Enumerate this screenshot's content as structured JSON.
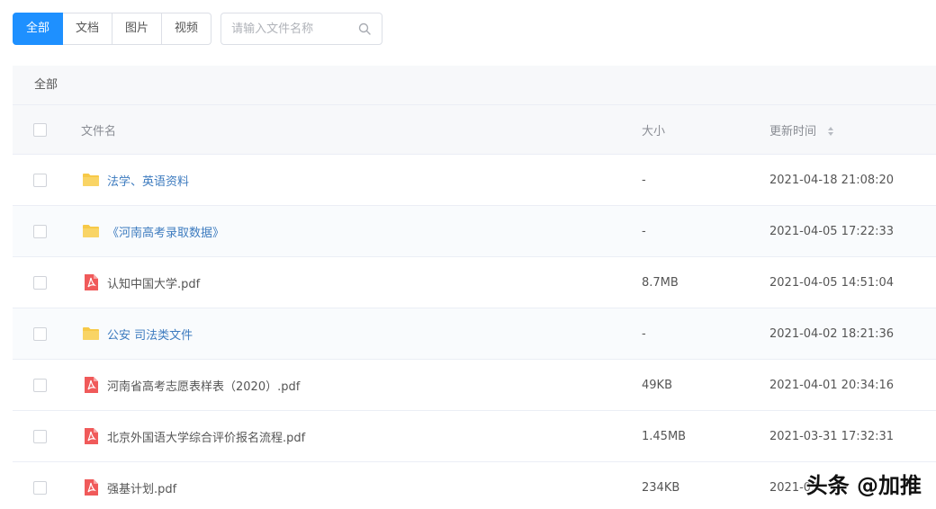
{
  "tabs": [
    {
      "label": "全部",
      "active": true
    },
    {
      "label": "文档",
      "active": false
    },
    {
      "label": "图片",
      "active": false
    },
    {
      "label": "视频",
      "active": false
    }
  ],
  "search": {
    "placeholder": "请输入文件名称",
    "icon": "search-icon"
  },
  "breadcrumb": "全部",
  "table": {
    "columns": {
      "name": "文件名",
      "size": "大小",
      "time": "更新时间"
    },
    "rows": [
      {
        "type": "folder",
        "name": "法学、英语资料",
        "size": "-",
        "time": "2021-04-18 21:08:20"
      },
      {
        "type": "folder",
        "name": "《河南高考录取数据》",
        "size": "-",
        "time": "2021-04-05 17:22:33"
      },
      {
        "type": "pdf",
        "name": "认知中国大学.pdf",
        "size": "8.7MB",
        "time": "2021-04-05 14:51:04"
      },
      {
        "type": "folder",
        "name": "公安 司法类文件",
        "size": "-",
        "time": "2021-04-02 18:21:36"
      },
      {
        "type": "pdf",
        "name": "河南省高考志愿表样表（2020）.pdf",
        "size": "49KB",
        "time": "2021-04-01 20:34:16"
      },
      {
        "type": "pdf",
        "name": "北京外国语大学综合评价报名流程.pdf",
        "size": "1.45MB",
        "time": "2021-03-31 17:32:31"
      },
      {
        "type": "pdf",
        "name": "强基计划.pdf",
        "size": "234KB",
        "time": "2021-03"
      }
    ]
  },
  "watermark": "头条 @加推",
  "colors": {
    "accent": "#1e90ff",
    "folder": "#f7c948",
    "pdf": "#f05a5a",
    "link": "#3d7bbf"
  }
}
